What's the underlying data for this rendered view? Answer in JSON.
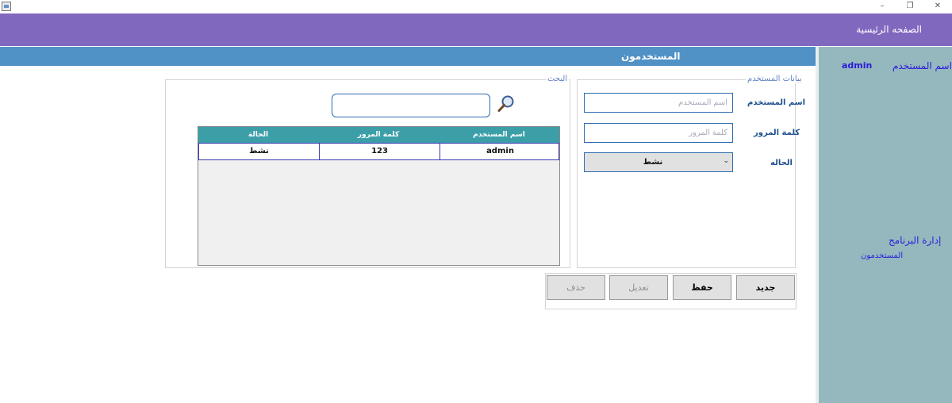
{
  "window": {
    "minimize_glyph": "–",
    "restore_glyph": "❐",
    "close_glyph": "✕"
  },
  "header": {
    "home_label": "الصفحه الرئيسية"
  },
  "main": {
    "title": "المستخدمون"
  },
  "sidebar": {
    "username_label": "اسم المستخدم",
    "username_value": "admin",
    "admin_link": "إدارة البرنامج",
    "users_link": "المستخدمون"
  },
  "user_data": {
    "group_title": "بيانات المستخدم",
    "username_label": "اسم المستخدم",
    "username_placeholder": "اسم المستخدم",
    "password_label": "كلمة المرور",
    "password_placeholder": "كلمة المرور",
    "status_label": "الحاله",
    "status_value": "نشط"
  },
  "search": {
    "group_title": "البحث",
    "placeholder": "",
    "icon": "search-icon"
  },
  "table": {
    "headers": {
      "username": "اسم المستخدم",
      "password": "كلمة المرور",
      "status": "الحالة"
    },
    "rows": [
      {
        "username": "admin",
        "password": "123",
        "status": "نشط"
      }
    ]
  },
  "buttons": {
    "new": "جديد",
    "save": "حفظ",
    "edit": "تعديل",
    "delete": "حذف"
  },
  "colors": {
    "header": "#8168bf",
    "title_strip": "#5092c6",
    "sidebar": "#94b8be",
    "table_header": "#3c9fa8",
    "link": "#2b1bd9"
  }
}
